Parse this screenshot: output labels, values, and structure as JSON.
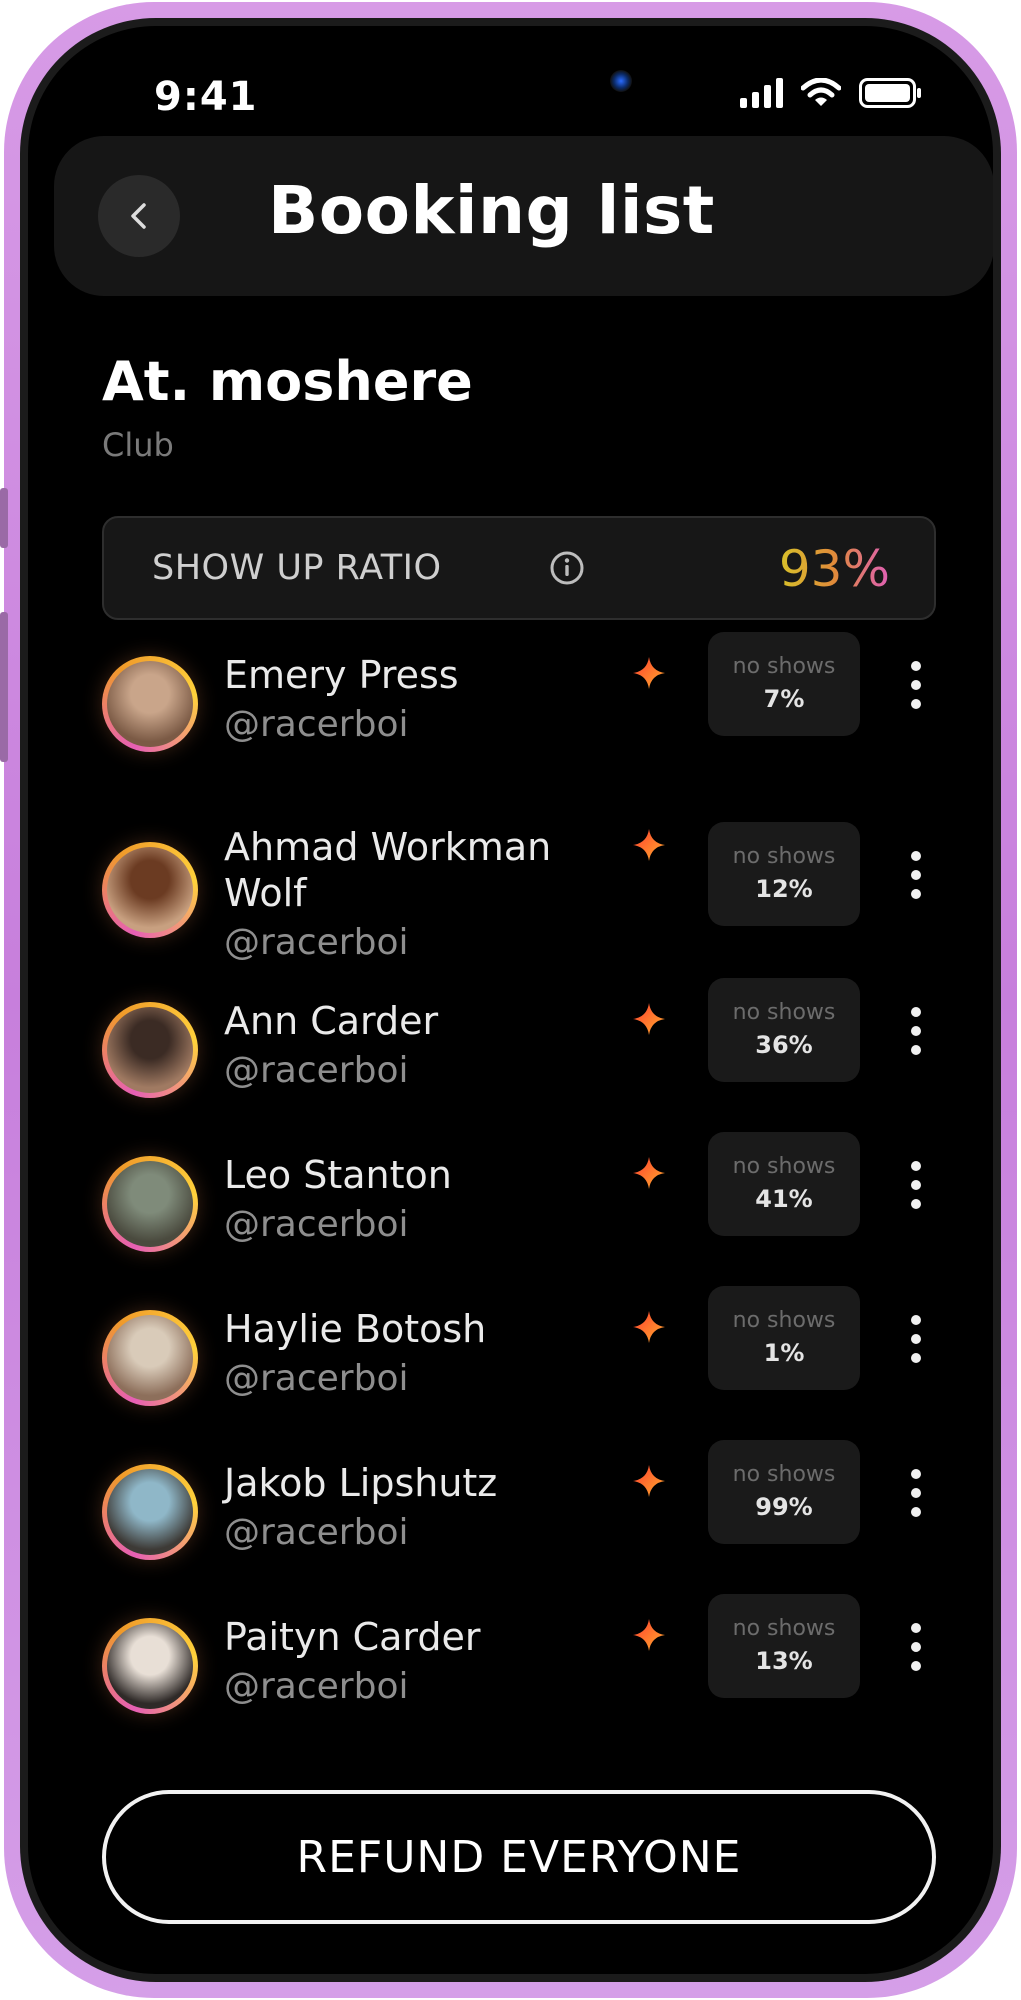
{
  "status_bar": {
    "time": "9:41"
  },
  "header": {
    "title": "Booking list"
  },
  "venue": {
    "name": "At. moshere",
    "type": "Club"
  },
  "show_up": {
    "label": "SHOW UP RATIO",
    "value": "93%"
  },
  "bookings": [
    {
      "name": "Emery Press",
      "handle": "@racerboi",
      "no_shows_label": "no shows",
      "no_shows": "7%",
      "avatar_colors": [
        "#c9a58a",
        "#7b5a45"
      ]
    },
    {
      "name": "Ahmad Workman Wolf",
      "handle": "@racerboi",
      "no_shows_label": "no shows",
      "no_shows": "12%",
      "avatar_colors": [
        "#6b3b22",
        "#c8a080"
      ]
    },
    {
      "name": "Ann Carder",
      "handle": "@racerboi",
      "no_shows_label": "no shows",
      "no_shows": "36%",
      "avatar_colors": [
        "#3b2b24",
        "#a07a62"
      ]
    },
    {
      "name": "Leo Stanton",
      "handle": "@racerboi",
      "no_shows_label": "no shows",
      "no_shows": "41%",
      "avatar_colors": [
        "#7f8b7a",
        "#4a4a3e"
      ]
    },
    {
      "name": "Haylie Botosh",
      "handle": "@racerboi",
      "no_shows_label": "no shows",
      "no_shows": "1%",
      "avatar_colors": [
        "#d9cbb9",
        "#8d6f5b"
      ]
    },
    {
      "name": "Jakob Lipshutz",
      "handle": "@racerboi",
      "no_shows_label": "no shows",
      "no_shows": "99%",
      "avatar_colors": [
        "#8fb7c8",
        "#3d3a36"
      ]
    },
    {
      "name": "Paityn Carder",
      "handle": "@racerboi",
      "no_shows_label": "no shows",
      "no_shows": "13%",
      "avatar_colors": [
        "#e8dfd6",
        "#2f2a28"
      ]
    }
  ],
  "footer": {
    "refund_label": "REFUND EVERYONE"
  },
  "colors": {
    "frame": "#d08be3",
    "background": "#000000",
    "accent_yellow": "#d8c22a",
    "accent_pink": "#e05fb6",
    "star_red": "#ff3b2f",
    "star_orange": "#ffb02e"
  },
  "icons": {
    "back": "chevron-left-icon",
    "info": "info-icon",
    "star": "sparkle-star-icon",
    "more": "more-vertical-icon",
    "signal": "cellular-signal-icon",
    "wifi": "wifi-icon",
    "battery": "battery-icon"
  }
}
